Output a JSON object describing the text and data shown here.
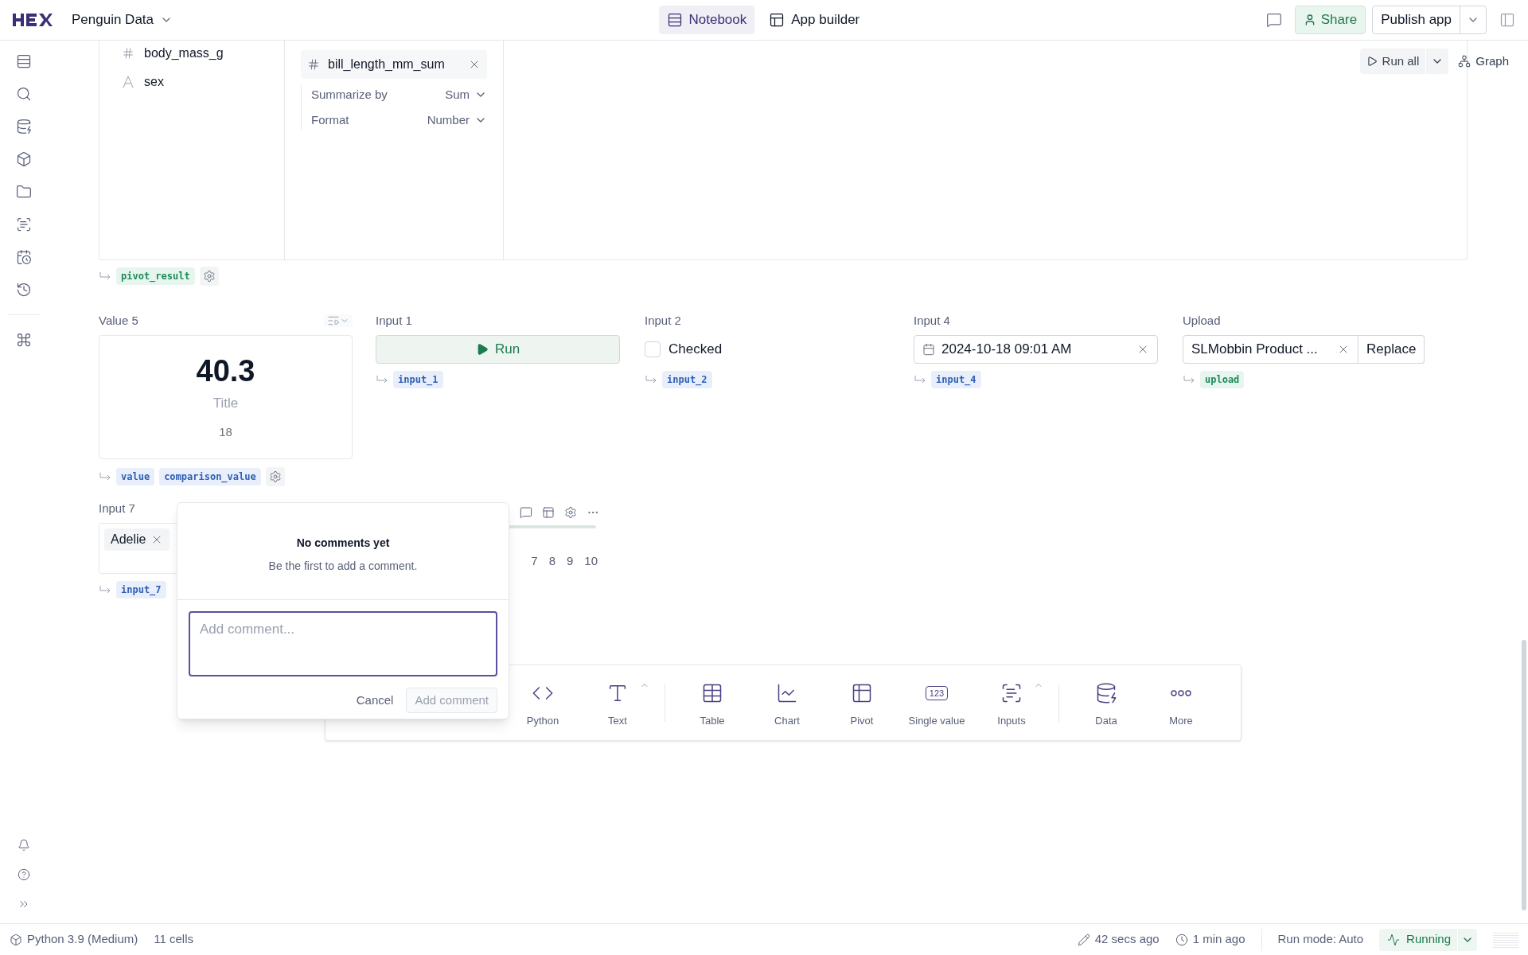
{
  "app": {
    "name": "Penguin Data"
  },
  "view_tabs": [
    {
      "label": "Notebook",
      "selected": true
    },
    {
      "label": "App builder",
      "selected": false
    }
  ],
  "header_actions": {
    "share": "Share",
    "publish": "Publish app"
  },
  "run_controls": {
    "run_all": "Run all",
    "graph": "Graph"
  },
  "pivot_cell": {
    "fields": [
      {
        "kind": "number",
        "name": "body_mass_g"
      },
      {
        "kind": "text",
        "name": "sex"
      }
    ],
    "value_field": {
      "name": "bill_length_mm_sum",
      "options": [
        {
          "label": "Summarize by",
          "value": "Sum"
        },
        {
          "label": "Format",
          "value": "Number"
        }
      ]
    },
    "outputs": [
      {
        "name": "pivot_result",
        "kind": "table"
      }
    ]
  },
  "value_cell": {
    "title": "Value 5",
    "value": "40.3",
    "label": "Title",
    "comparison": "18",
    "outputs": [
      {
        "name": "value",
        "kind": "value"
      },
      {
        "name": "comparison_value",
        "kind": "value"
      }
    ]
  },
  "inputs": [
    {
      "kind": "button",
      "title": "Input 1",
      "label": "Run",
      "outputs": [
        {
          "name": "input_1",
          "kind": "value"
        }
      ]
    },
    {
      "kind": "checkbox",
      "title": "Input 2",
      "label": "Checked",
      "checked": false,
      "outputs": [
        {
          "name": "input_2",
          "kind": "value"
        }
      ]
    },
    {
      "kind": "date",
      "title": "Input 4",
      "value": "2024-10-18 09:01 AM",
      "outputs": [
        {
          "name": "input_4",
          "kind": "value"
        }
      ]
    },
    {
      "kind": "upload",
      "title": "Upload",
      "file": "SLMobbin Product ...",
      "action": "Replace",
      "outputs": [
        {
          "name": "upload",
          "kind": "table"
        }
      ]
    }
  ],
  "multiselect": {
    "title": "Input 7",
    "chips": [
      "Adelie"
    ],
    "outputs": [
      {
        "name": "input_7",
        "kind": "value"
      }
    ]
  },
  "slider": {
    "ticks": [
      "7",
      "8",
      "9",
      "10"
    ]
  },
  "comments": {
    "title": "No comments yet",
    "subtitle": "Be the first to add a comment.",
    "placeholder": "Add comment...",
    "cancel": "Cancel",
    "submit": "Add comment"
  },
  "add_cell_bar": {
    "items": [
      {
        "kind": "python",
        "label": "Python"
      },
      {
        "kind": "text",
        "label": "Text",
        "menu": true
      },
      {
        "kind": "table",
        "label": "Table"
      },
      {
        "kind": "chart",
        "label": "Chart"
      },
      {
        "kind": "pivot",
        "label": "Pivot"
      },
      {
        "kind": "single_value",
        "label": "Single value",
        "badge": "123"
      },
      {
        "kind": "inputs",
        "label": "Inputs",
        "menu": true
      },
      {
        "kind": "data",
        "label": "Data"
      },
      {
        "kind": "more",
        "label": "More"
      }
    ]
  },
  "status_bar": {
    "kernel": "Python 3.9 (Medium)",
    "cells": "11 cells",
    "edited": "42 secs ago",
    "ran": "1 min ago",
    "run_mode": "Run mode: Auto",
    "status": "Running"
  }
}
